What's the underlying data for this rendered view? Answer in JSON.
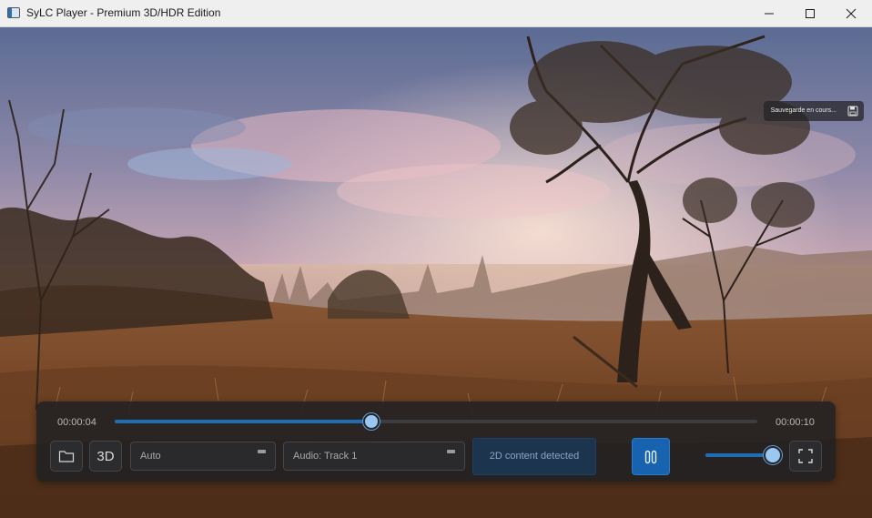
{
  "window": {
    "title": "SyLC Player - Premium 3D/HDR Edition"
  },
  "video": {
    "description": "Autumn landscape at sunset with dry grass, trees and pink clouds",
    "save_toast": "Sauvegarde en cours..."
  },
  "controls": {
    "current_time": "00:00:04",
    "total_time": "00:00:10",
    "progress": 0.4,
    "mode_3d_label": "3D",
    "mode_select_value": "Auto",
    "audio_select_value": "Audio: Track 1",
    "detection_status": "2D content detected",
    "volume": 1.0
  },
  "icons": {
    "app": "app-icon",
    "minimize": "minimize-icon",
    "maximize": "maximize-icon",
    "close": "close-icon",
    "save": "save-icon",
    "open_folder": "folder-icon",
    "pause": "pause-icon",
    "fullscreen": "fullscreen-icon"
  },
  "colors": {
    "accent": "#1763b0",
    "titlebar": "#efefef",
    "panel": "#212123",
    "detection_bg": "#1c344d"
  }
}
